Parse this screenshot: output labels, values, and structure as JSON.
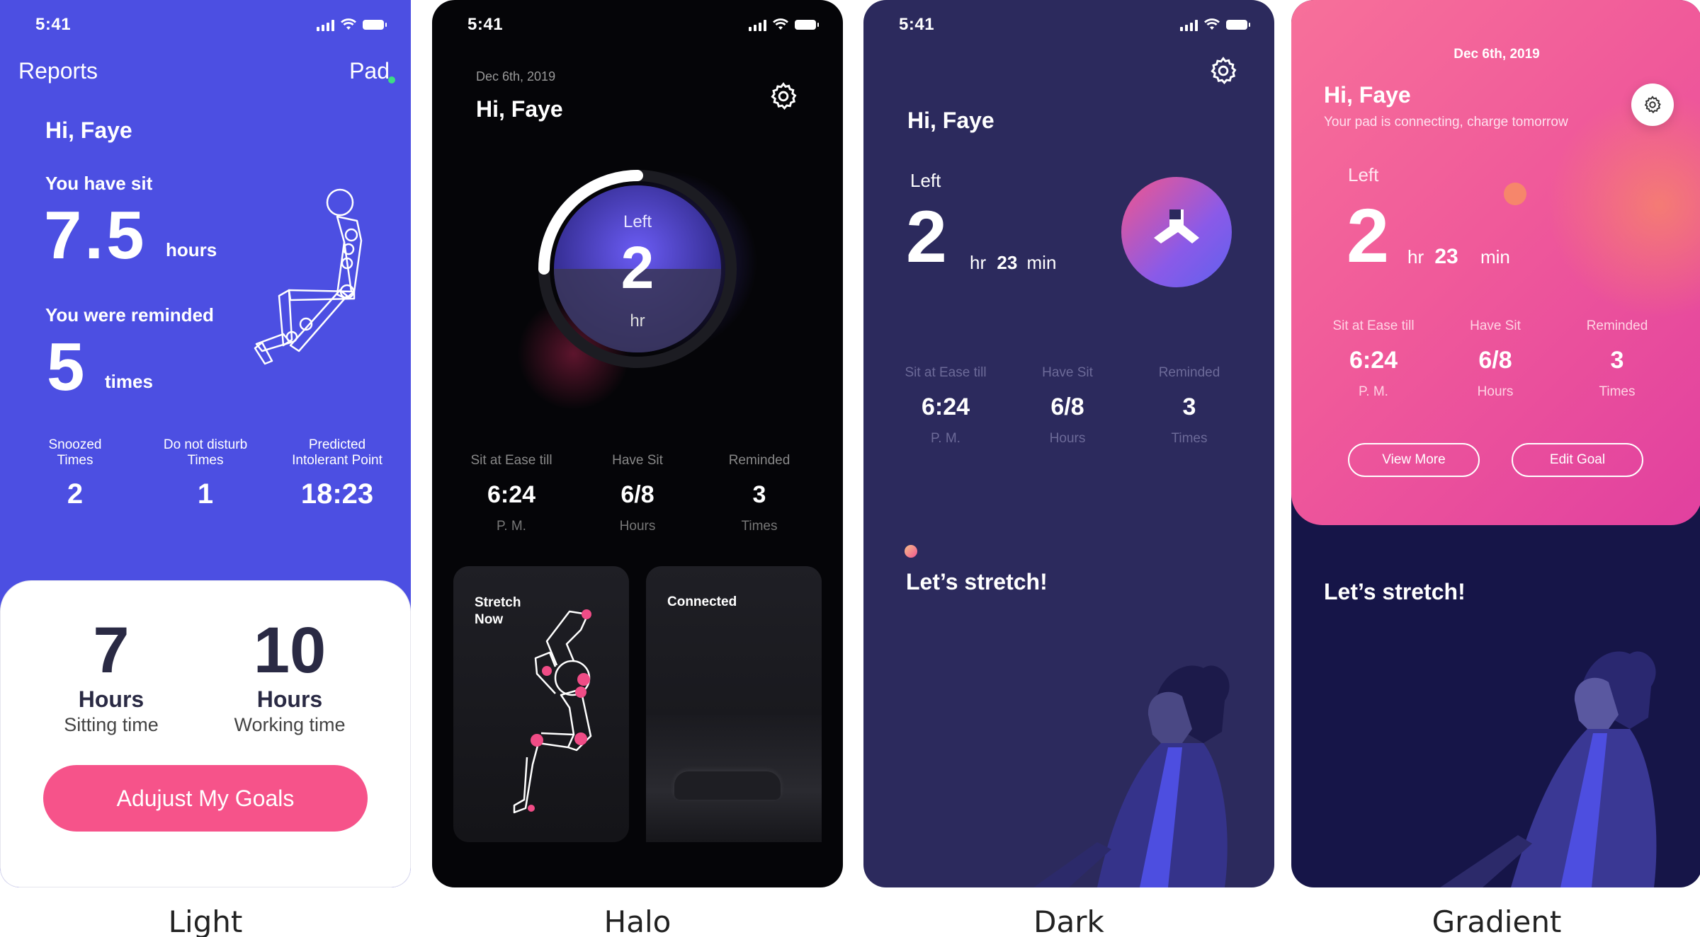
{
  "status_time": "5:41",
  "captions": [
    "Light",
    "Halo",
    "Dark",
    "Gradient"
  ],
  "light": {
    "title": "Reports",
    "pad": "Pad",
    "greeting": "Hi, Faye",
    "sit_label": "You have sit",
    "sit_value": "7.5",
    "sit_unit": "hours",
    "remind_label": "You were reminded",
    "remind_value": "5",
    "remind_unit": "times",
    "stats": [
      {
        "label": "Snoozed\nTimes",
        "value": "2"
      },
      {
        "label": "Do not disturb\nTimes",
        "value": "1"
      },
      {
        "label": "Predicted\nIntolerant Point",
        "value": "18:23"
      }
    ],
    "sitting": {
      "value": "7",
      "unit": "Hours",
      "label": "Sitting time"
    },
    "working": {
      "value": "10",
      "unit": "Hours",
      "label": "Working time"
    },
    "cta": "Adujust My Goals"
  },
  "halo": {
    "date": "Dec 6th, 2019",
    "greeting": "Hi, Faye",
    "ring_label": "Left",
    "ring_value": "2",
    "ring_unit": "hr",
    "stats": [
      {
        "label": "Sit at Ease till",
        "value": "6:24",
        "unit": "P. M."
      },
      {
        "label": "Have Sit",
        "value": "6/8",
        "unit": "Hours"
      },
      {
        "label": "Reminded",
        "value": "3",
        "unit": "Times"
      }
    ],
    "card1": "Stretch\nNow",
    "card2": "Connected"
  },
  "dark": {
    "greeting": "Hi, Faye",
    "left_label": "Left",
    "hours": "2",
    "hr": "hr",
    "minutes": "23",
    "min": "min",
    "stats": [
      {
        "label": "Sit at Ease till",
        "value": "6:24",
        "unit": "P. M."
      },
      {
        "label": "Have Sit",
        "value": "6/8",
        "unit": "Hours"
      },
      {
        "label": "Reminded",
        "value": "3",
        "unit": "Times"
      }
    ],
    "stretch": "Let’s stretch!"
  },
  "gradient": {
    "date": "Dec 6th, 2019",
    "greeting": "Hi, Faye",
    "subtitle": "Your pad is connecting, charge tomorrow",
    "left_label": "Left",
    "hours": "2",
    "hr": "hr",
    "minutes": "23",
    "min": "min",
    "stats": [
      {
        "label": "Sit at Ease till",
        "value": "6:24",
        "unit": "P. M."
      },
      {
        "label": "Have Sit",
        "value": "6/8",
        "unit": "Hours"
      },
      {
        "label": "Reminded",
        "value": "3",
        "unit": "Times"
      }
    ],
    "view_more": "View More",
    "edit_goal": "Edit Goal",
    "stretch": "Let’s stretch!"
  },
  "colors": {
    "light_bg": "#4c4fe2",
    "accent_pink": "#f6538a",
    "halo_bg": "#050508",
    "dark_bg": "#2c2a5d",
    "gradient_top": "#f05a9a",
    "gradient_bottom": "#161548",
    "status_dot": "#3ddc84"
  },
  "icons": [
    "signal-icon",
    "wifi-icon",
    "battery-icon",
    "gear-icon",
    "chair-icon",
    "posture-figure-icon",
    "stretch-figure-icon"
  ]
}
